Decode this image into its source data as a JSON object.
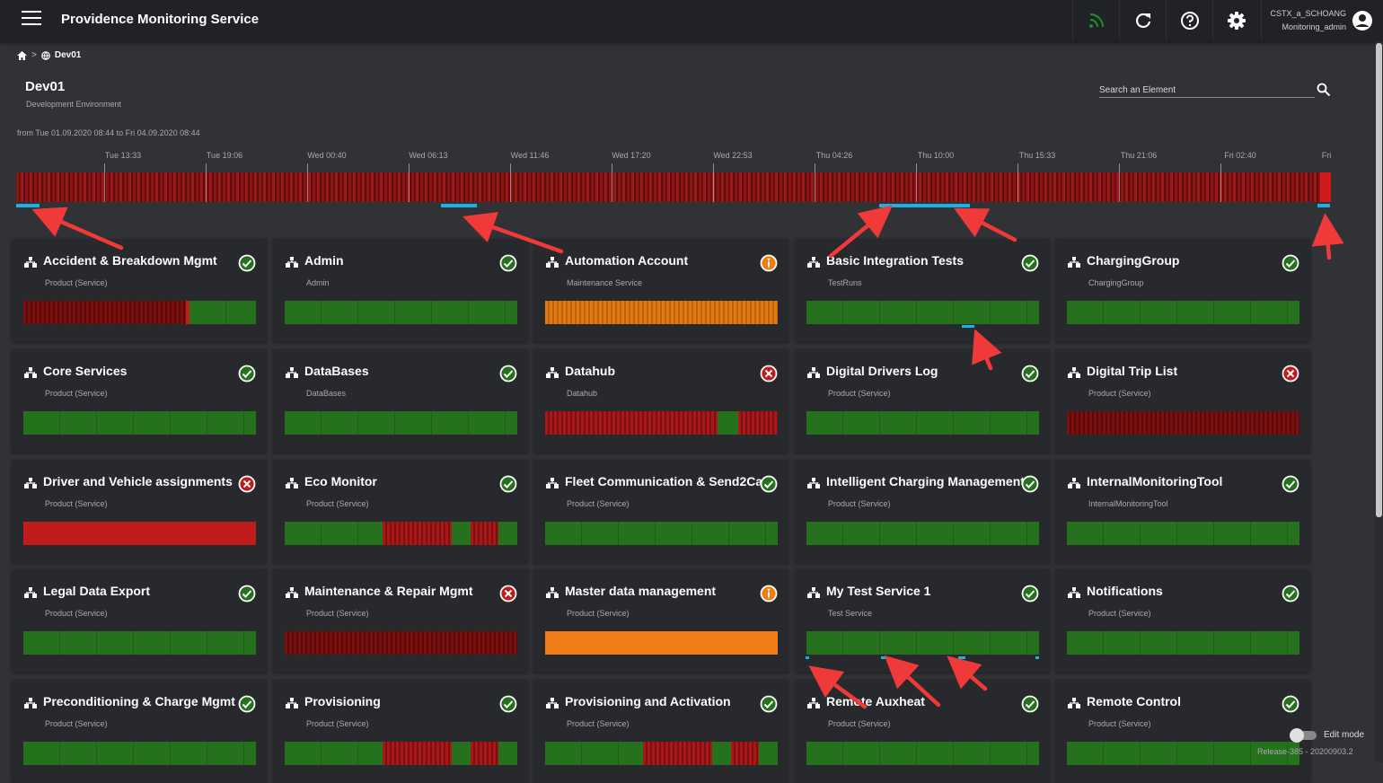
{
  "app": {
    "title": "Providence Monitoring Service"
  },
  "user": {
    "name": "CSTX_a_SCHOANG",
    "role": "Monitoring_admin"
  },
  "toolbar": {
    "icons": [
      "rss-icon",
      "refresh-icon",
      "help-icon",
      "settings-icon",
      "account-icon"
    ]
  },
  "breadcrumb": {
    "separator": ">",
    "current": "Dev01"
  },
  "page": {
    "title": "Dev01",
    "subtitle": "Development Environment"
  },
  "search": {
    "placeholder": "Search an Element"
  },
  "timeline": {
    "range": "from Tue 01.09.2020 08:44 to Fri 04.09.2020 08:44",
    "ticks": [
      "Tue 13:33",
      "Tue 19:06",
      "Wed 00:40",
      "Wed 06:13",
      "Wed 11:46",
      "Wed 17:20",
      "Wed 22:53",
      "Thu 04:26",
      "Thu 10:00",
      "Thu 15:33",
      "Thu 21:06",
      "Fri 02:40",
      "Fri"
    ]
  },
  "colors": {
    "ok": "#25711e",
    "warning": "#f07d16",
    "error": "#c01c1c",
    "selection": "#1ab0e8",
    "background": "#303236"
  },
  "cards": [
    {
      "title": "Accident & Breakdown Mgmt",
      "subtitle": "Product (Service)",
      "status": "ok",
      "bar": "mixed-red-green"
    },
    {
      "title": "Admin",
      "subtitle": "Admin",
      "status": "ok",
      "bar": "green"
    },
    {
      "title": "Automation Account",
      "subtitle": "Maintenance Service",
      "status": "warning",
      "bar": "orange-stripe"
    },
    {
      "title": "Basic Integration Tests",
      "subtitle": "TestRuns",
      "status": "ok",
      "bar": "green"
    },
    {
      "title": "ChargingGroup",
      "subtitle": "ChargingGroup",
      "status": "ok",
      "bar": "green"
    },
    {
      "title": "Core Services",
      "subtitle": "Product (Service)",
      "status": "ok",
      "bar": "green"
    },
    {
      "title": "DataBases",
      "subtitle": "DataBases",
      "status": "ok",
      "bar": "green"
    },
    {
      "title": "Datahub",
      "subtitle": "Datahub",
      "status": "error",
      "bar": "red-stripe-green"
    },
    {
      "title": "Digital Drivers Log",
      "subtitle": "Product (Service)",
      "status": "ok",
      "bar": "green"
    },
    {
      "title": "Digital Trip List",
      "subtitle": "Product (Service)",
      "status": "error",
      "bar": "red-dark"
    },
    {
      "title": "Driver and Vehicle assignments",
      "subtitle": "Product (Service)",
      "status": "error",
      "bar": "red"
    },
    {
      "title": "Eco Monitor",
      "subtitle": "Product (Service)",
      "status": "ok",
      "bar": "green-red-mix"
    },
    {
      "title": "Fleet Communication & Send2Car",
      "subtitle": "Product (Service)",
      "status": "ok",
      "bar": "green"
    },
    {
      "title": "Intelligent Charging Management",
      "subtitle": "Product (Service)",
      "status": "ok",
      "bar": "green"
    },
    {
      "title": "InternalMonitoringTool",
      "subtitle": "InternalMonitoringTool",
      "status": "ok",
      "bar": "green"
    },
    {
      "title": "Legal Data Export",
      "subtitle": "Product (Service)",
      "status": "ok",
      "bar": "green"
    },
    {
      "title": "Maintenance & Repair Mgmt",
      "subtitle": "Product (Service)",
      "status": "error",
      "bar": "red-dark"
    },
    {
      "title": "Master data management",
      "subtitle": "Product (Service)",
      "status": "warning",
      "bar": "orange"
    },
    {
      "title": "My Test Service 1",
      "subtitle": "Test Service",
      "status": "ok",
      "bar": "green"
    },
    {
      "title": "Notifications",
      "subtitle": "Product (Service)",
      "status": "ok",
      "bar": "green"
    },
    {
      "title": "Preconditioning & Charge Mgmt",
      "subtitle": "Product (Service)",
      "status": "ok",
      "bar": "green"
    },
    {
      "title": "Provisioning",
      "subtitle": "Product (Service)",
      "status": "ok",
      "bar": "green-red-mix"
    },
    {
      "title": "Provisioning and Activation",
      "subtitle": "Product (Service)",
      "status": "ok",
      "bar": "green-red-mix"
    },
    {
      "title": "Remote Auxheat",
      "subtitle": "Product (Service)",
      "status": "ok",
      "bar": "green"
    },
    {
      "title": "Remote Control",
      "subtitle": "Product (Service)",
      "status": "ok",
      "bar": "green"
    }
  ],
  "footer": {
    "edit_mode_label": "Edit mode",
    "release": "Release-385 - 20200903.2"
  }
}
